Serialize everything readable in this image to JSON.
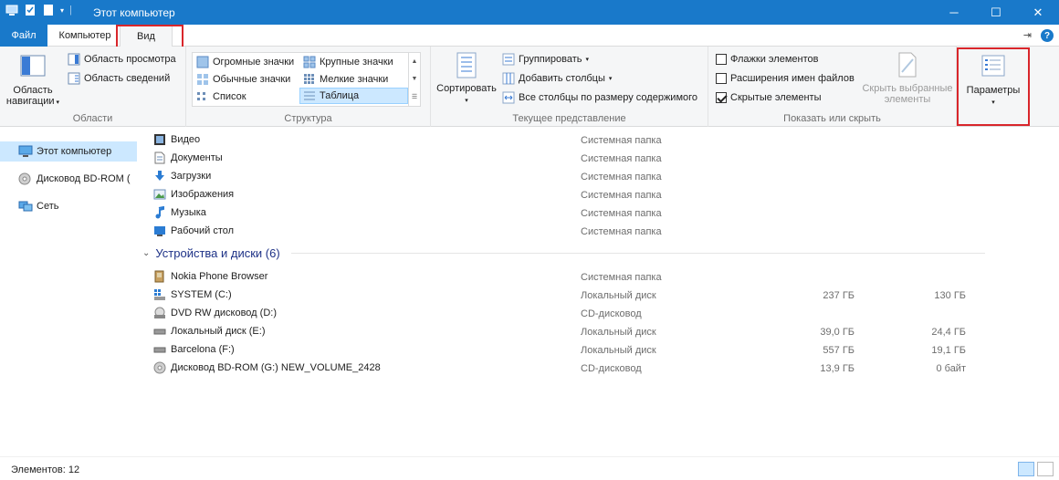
{
  "window": {
    "title": "Этот компьютер",
    "minimize": "─",
    "maximize": "☐",
    "close": "✕"
  },
  "ribbon_tabs": {
    "file": "Файл",
    "computer": "Компьютер",
    "view": "Вид",
    "pin": "⇥",
    "help": "?"
  },
  "areas_group": {
    "nav_pane": "Область\nнавигации",
    "preview_pane": "Область просмотра",
    "details_pane": "Область сведений",
    "label": "Области"
  },
  "layout_group": {
    "items": [
      "Огромные значки",
      "Крупные значки",
      "Обычные значки",
      "Мелкие значки",
      "Список",
      "Таблица"
    ],
    "selected": "Таблица",
    "label": "Структура"
  },
  "current_view_group": {
    "sort": "Сортировать",
    "group_by": "Группировать",
    "add_columns": "Добавить столбцы",
    "fit_columns": "Все столбцы по размеру содержимого",
    "label": "Текущее представление"
  },
  "show_hide_group": {
    "checkboxes": [
      {
        "label": "Флажки элементов",
        "checked": false
      },
      {
        "label": "Расширения имен файлов",
        "checked": false
      },
      {
        "label": "Скрытые элементы",
        "checked": true
      }
    ],
    "hide_selected": "Скрыть выбранные\nэлементы",
    "label": "Показать или скрыть"
  },
  "options": {
    "label": "Параметры"
  },
  "nav_pane": {
    "items": [
      {
        "label": "Этот компьютер",
        "icon": "computer-icon",
        "selected": true
      },
      {
        "label": "Дисковод BD-ROM (",
        "icon": "disc-icon",
        "selected": false
      },
      {
        "label": "Сеть",
        "icon": "network-icon",
        "selected": false
      }
    ]
  },
  "folders": [
    {
      "name": "Видео",
      "type": "Системная папка",
      "icon": "video-folder-icon"
    },
    {
      "name": "Документы",
      "type": "Системная папка",
      "icon": "documents-folder-icon"
    },
    {
      "name": "Загрузки",
      "type": "Системная папка",
      "icon": "downloads-folder-icon"
    },
    {
      "name": "Изображения",
      "type": "Системная папка",
      "icon": "pictures-folder-icon"
    },
    {
      "name": "Музыка",
      "type": "Системная папка",
      "icon": "music-folder-icon"
    },
    {
      "name": "Рабочий стол",
      "type": "Системная папка",
      "icon": "desktop-folder-icon"
    }
  ],
  "devices_group": {
    "title": "Устройства и диски (6)"
  },
  "devices": [
    {
      "name": "Nokia Phone Browser",
      "type": "Системная папка",
      "total": "",
      "free": "",
      "icon": "phone-icon"
    },
    {
      "name": "SYSTEM (C:)",
      "type": "Локальный диск",
      "total": "237 ГБ",
      "free": "130 ГБ",
      "icon": "system-drive-icon"
    },
    {
      "name": "DVD RW дисковод (D:)",
      "type": "CD-дисковод",
      "total": "",
      "free": "",
      "icon": "dvd-drive-icon"
    },
    {
      "name": "Локальный диск (E:)",
      "type": "Локальный диск",
      "total": "39,0 ГБ",
      "free": "24,4 ГБ",
      "icon": "drive-icon"
    },
    {
      "name": "Barcelona (F:)",
      "type": "Локальный диск",
      "total": "557 ГБ",
      "free": "19,1 ГБ",
      "icon": "drive-icon"
    },
    {
      "name": "Дисковод BD-ROM (G:) NEW_VOLUME_2428",
      "type": "CD-дисковод",
      "total": "13,9 ГБ",
      "free": "0 байт",
      "icon": "disc-icon"
    }
  ],
  "status": {
    "count": "Элементов: 12"
  },
  "colors": {
    "accent": "#1979ca",
    "highlight_box": "#d9262b",
    "selection": "#cce8ff"
  }
}
